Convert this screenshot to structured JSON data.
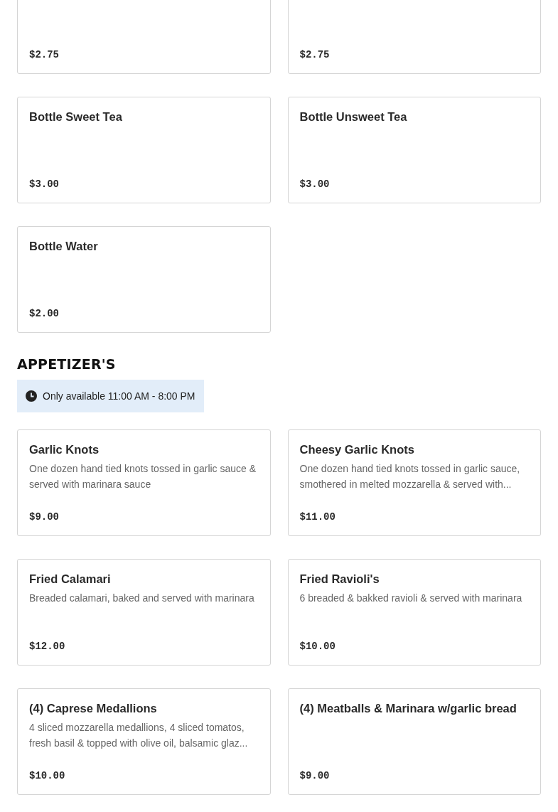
{
  "sections": [
    {
      "items": [
        {
          "price": "$2.75"
        },
        {
          "price": "$2.75"
        },
        {
          "name": "Bottle Sweet Tea",
          "price": "$3.00"
        },
        {
          "name": "Bottle Unsweet Tea",
          "price": "$3.00"
        },
        {
          "name": "Bottle Water",
          "price": "$2.00"
        }
      ]
    },
    {
      "heading": "APPETIZER'S",
      "availability": "Only available 11:00 AM - 8:00 PM",
      "items": [
        {
          "name": "Garlic Knots",
          "description": "One dozen hand tied knots tossed in garlic sauce & served with marinara sauce",
          "price": "$9.00"
        },
        {
          "name": "Cheesy Garlic Knots",
          "description": "One dozen hand tied knots tossed in garlic sauce, smothered in melted mozzarella & served with...",
          "price": "$11.00"
        },
        {
          "name": "Fried Calamari",
          "description": "Breaded calamari, baked and served with marinara",
          "price": "$12.00"
        },
        {
          "name": "Fried Ravioli's",
          "description": "6 breaded & bakked ravioli & served with marinara",
          "price": "$10.00"
        },
        {
          "name": "(4) Caprese Medallions",
          "description": "4 sliced mozzarella medallions, 4 sliced tomatos, fresh basil & topped with olive oil, balsamic glaz...",
          "price": "$10.00"
        },
        {
          "name": "(4) Meatballs & Marinara w/garlic bread",
          "price": "$9.00"
        }
      ]
    }
  ]
}
